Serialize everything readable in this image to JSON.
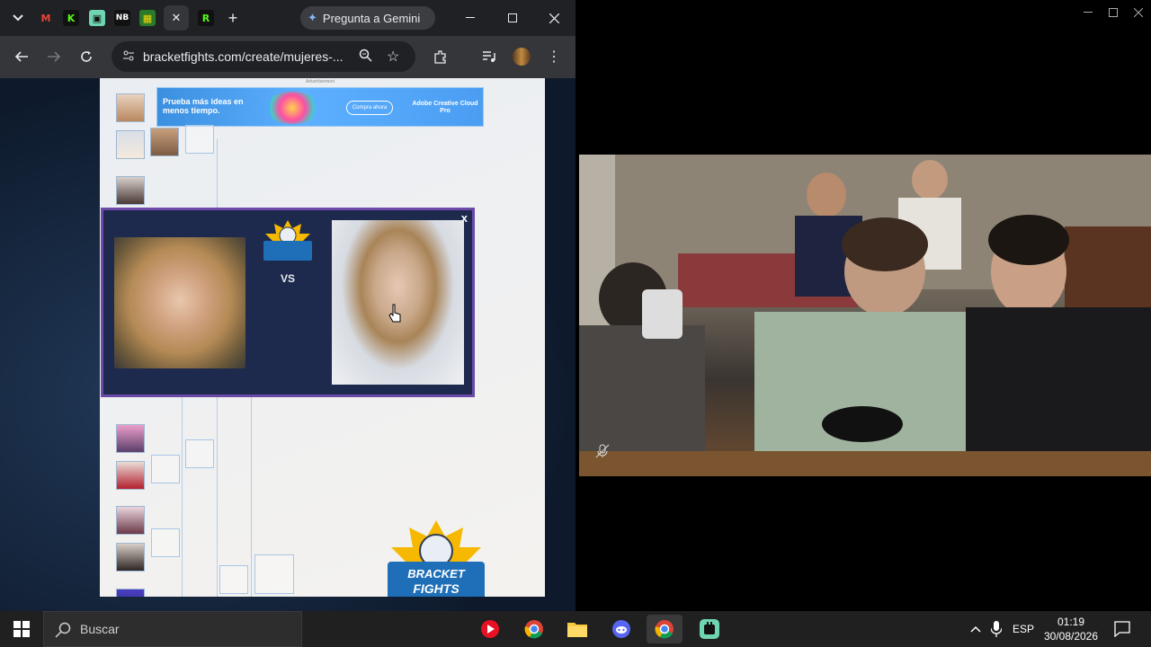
{
  "browser": {
    "gemini_label": "Pregunta a Gemini",
    "url": "bracketfights.com/create/mujeres-...",
    "new_tab_symbol": "+",
    "tab_close_symbol": "✕"
  },
  "page": {
    "ad_label": "Advertisement",
    "ad_text": "Prueba más ideas en menos tiempo.",
    "ad_cta": "Compra ahora",
    "ad_brand": "Adobe Creative Cloud Pro",
    "modal_close": "x",
    "vs_label": "VS",
    "logo_text_top": "BRACKET",
    "logo_text_bottom": "FIGHTS"
  },
  "taskbar": {
    "search_placeholder": "Buscar",
    "language": "ESP",
    "time": "01:19",
    "date": "30/08/2026"
  },
  "colors": {
    "tabbar": "#202124",
    "toolbar": "#35363a",
    "modal_bg": "#1d2a4d",
    "modal_border": "#6b4aa8",
    "taskbar": "#202020"
  }
}
